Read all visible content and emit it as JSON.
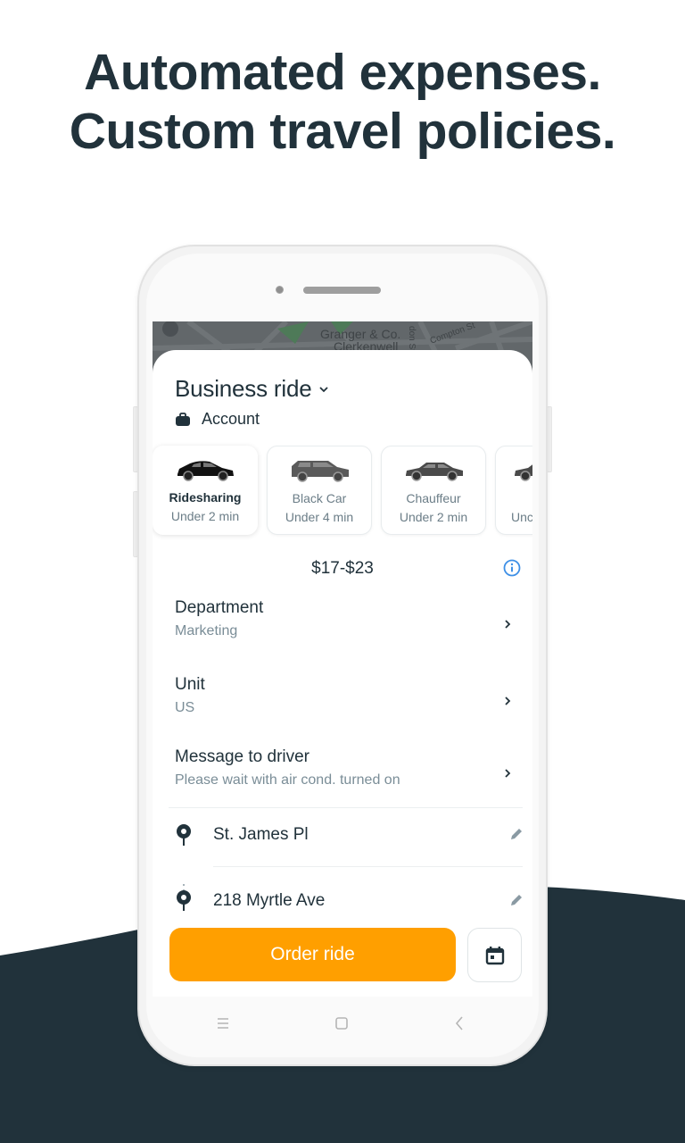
{
  "headline": {
    "line1": "Automated expenses.",
    "line2": "Custom travel policies."
  },
  "colors": {
    "dark": "#21323b",
    "accent": "#ff9f00",
    "info": "#3d8fe6",
    "muted": "#7a8d97"
  },
  "map": {
    "labels": [
      "Granger & Co.",
      "Clerkenwell",
      "Compton St",
      "don St"
    ]
  },
  "header": {
    "title": "Business ride",
    "title_icon": "chevron-down-icon",
    "account_icon": "briefcase-icon",
    "account_label": "Account"
  },
  "tariffs": [
    {
      "name": "Ridesharing",
      "eta": "Under 2 min",
      "selected": true
    },
    {
      "name": "Black Car",
      "eta": "Under 4 min",
      "selected": false
    },
    {
      "name": "Chauffeur",
      "eta": "Under 2 min",
      "selected": false
    },
    {
      "name": "",
      "eta": "Unc",
      "selected": false
    }
  ],
  "price": {
    "range": "$17-$23",
    "info_icon": "info-icon"
  },
  "details": [
    {
      "title": "Department",
      "value": "Marketing"
    },
    {
      "title": "Unit",
      "value": "US"
    },
    {
      "title": "Message to driver",
      "value": "Please wait with air cond. turned on"
    }
  ],
  "route": {
    "from": "St. James Pl",
    "to": "218 Myrtle Ave"
  },
  "actions": {
    "order_label": "Order ride",
    "schedule_icon": "calendar-icon"
  },
  "system_nav": {
    "recent": "menu-icon",
    "home": "home-icon",
    "back": "back-icon"
  }
}
